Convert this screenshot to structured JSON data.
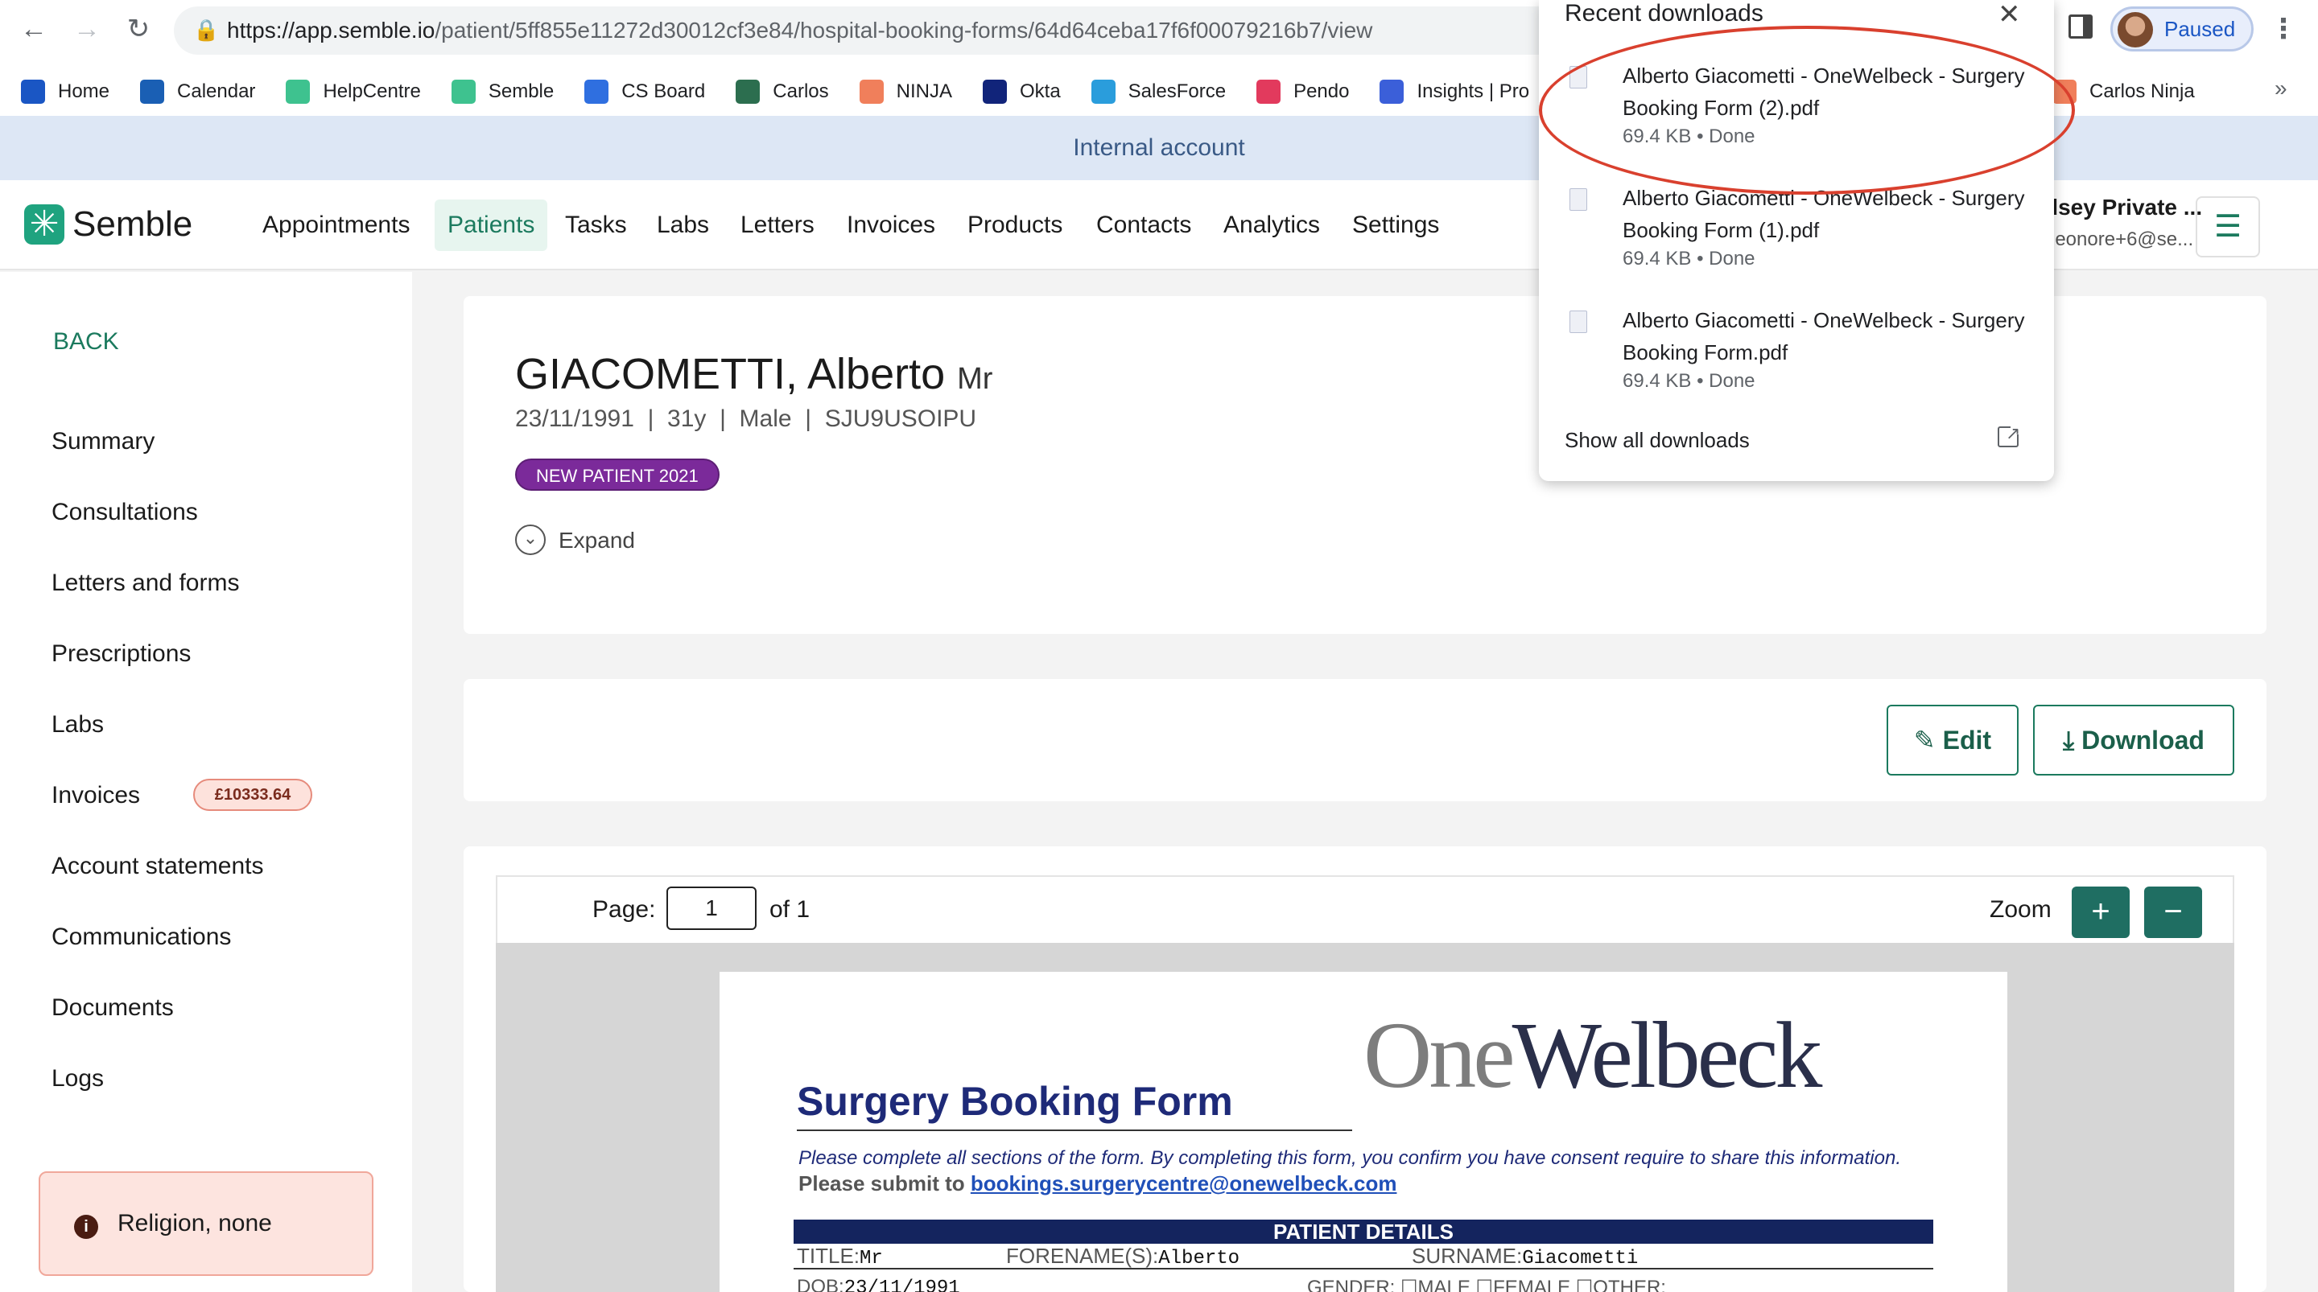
{
  "browser": {
    "url_host": "https://app.semble.io",
    "url_path": "/patient/5ff855e11272d30012cf3e84/hospital-booking-forms/64d64ceba17f6f00079216b7/view",
    "profile_status": "Paused",
    "bookmarks": [
      {
        "label": "Home",
        "icon": "home-icon",
        "color": "#1a56c4"
      },
      {
        "label": "Calendar",
        "icon": "calendar-icon",
        "color": "#1a5fb4"
      },
      {
        "label": "HelpCentre",
        "icon": "semble-icon",
        "color": "#3ec28f"
      },
      {
        "label": "Semble",
        "icon": "semble-icon",
        "color": "#3ec28f"
      },
      {
        "label": "CS Board",
        "icon": "jira-icon",
        "color": "#2f6fe0"
      },
      {
        "label": "Carlos",
        "icon": "sheet-icon",
        "color": "#2c6e4f"
      },
      {
        "label": "NINJA",
        "icon": "ninja-icon",
        "color": "#f07f5b"
      },
      {
        "label": "Okta",
        "icon": "okta-icon",
        "color": "#11247a"
      },
      {
        "label": "SalesForce",
        "icon": "salesforce-icon",
        "color": "#2a9ddc"
      },
      {
        "label": "Pendo",
        "icon": "pendo-icon",
        "color": "#e23a5d"
      },
      {
        "label": "Insights | Pro",
        "icon": "insights-icon",
        "color": "#3b5fd9"
      },
      {
        "label": "Carlos Ninja",
        "icon": "ninja-icon",
        "color": "#f07f5b"
      }
    ],
    "more_label": "»"
  },
  "banner": {
    "text": "Internal account"
  },
  "app_nav": {
    "logo_text": "Semble",
    "items": [
      "Appointments",
      "Patients",
      "Tasks",
      "Labs",
      "Letters",
      "Invoices",
      "Products",
      "Contacts",
      "Analytics",
      "Settings"
    ],
    "active": "Patients",
    "user_name": "dsey Private ...",
    "user_email": "leonore+6@se..."
  },
  "sidebar": {
    "back_label": "BACK",
    "items": [
      "Summary",
      "Consultations",
      "Letters and forms",
      "Prescriptions",
      "Labs",
      "Invoices",
      "Account statements",
      "Communications",
      "Documents",
      "Logs"
    ],
    "invoice_badge": "£10333.64",
    "alert_text": "Religion, none"
  },
  "patient": {
    "name": "GIACOMETTI, Alberto",
    "title": "Mr",
    "meta": "23/11/1991  |  31y  |  Male  |  SJU9USOIPU",
    "tag": "NEW PATIENT 2021",
    "expand_label": "Expand"
  },
  "actions": {
    "edit_label": "Edit",
    "download_label": "Download"
  },
  "pdf_viewer": {
    "page_label": "Page:",
    "page_value": "1",
    "page_of": "of 1",
    "zoom_label": "Zoom",
    "zoom_in": "+",
    "zoom_out": "−"
  },
  "pdf_document": {
    "logo_one": "One",
    "logo_welbeck": "Welbeck",
    "title": "Surgery Booking Form",
    "instructions": "Please complete all sections of the form. By completing this form, you confirm you have consent require to share this information.",
    "submit_prefix": "Please submit to ",
    "submit_email": "bookings.surgerycentre@onewelbeck.com",
    "section_title": "PATIENT DETAILS",
    "title_label": "TITLE:",
    "title_value": "Mr",
    "forename_label": "FORENAME(S):",
    "forename_value": "Alberto",
    "surname_label": "SURNAME:",
    "surname_value": "Giacometti",
    "dob_label": "DOB:",
    "dob_value": "23/11/1991",
    "gender_label": "GENDER: ☐MALE  ☐FEMALE  ☐OTHER:"
  },
  "downloads": {
    "title": "Recent downloads",
    "items": [
      {
        "name": "Alberto Giacometti - OneWelbeck - Surgery Booking Form (2).pdf",
        "meta": "69.4 KB • Done"
      },
      {
        "name": "Alberto Giacometti - OneWelbeck - Surgery Booking Form (1).pdf",
        "meta": "69.4 KB • Done"
      },
      {
        "name": "Alberto Giacometti - OneWelbeck - Surgery Booking Form.pdf",
        "meta": "69.4 KB • Done"
      }
    ],
    "show_all": "Show all downloads",
    "highlight_color": "#d9402e"
  },
  "colors": {
    "brand": "#1fa37f",
    "accent": "#1b7a5e",
    "tag": "#7b2a9a",
    "pdf_navy": "#14245e"
  }
}
